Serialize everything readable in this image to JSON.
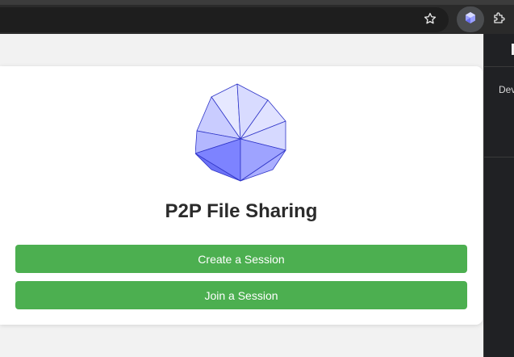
{
  "browser": {
    "toolbar_icons": [
      "star-icon",
      "extension-icon",
      "puzzle-icon"
    ]
  },
  "side_panel": {
    "label": "Dev"
  },
  "app": {
    "title": "P2P File Sharing",
    "logo": "icosahedron-icon",
    "buttons": {
      "create_session": "Create a Session",
      "join_session": "Join a Session"
    }
  },
  "colors": {
    "accent_green": "#4caf50",
    "logo_light": "#e6e8ff",
    "logo_mid": "#b8bcff",
    "logo_dark": "#7a80ff"
  }
}
